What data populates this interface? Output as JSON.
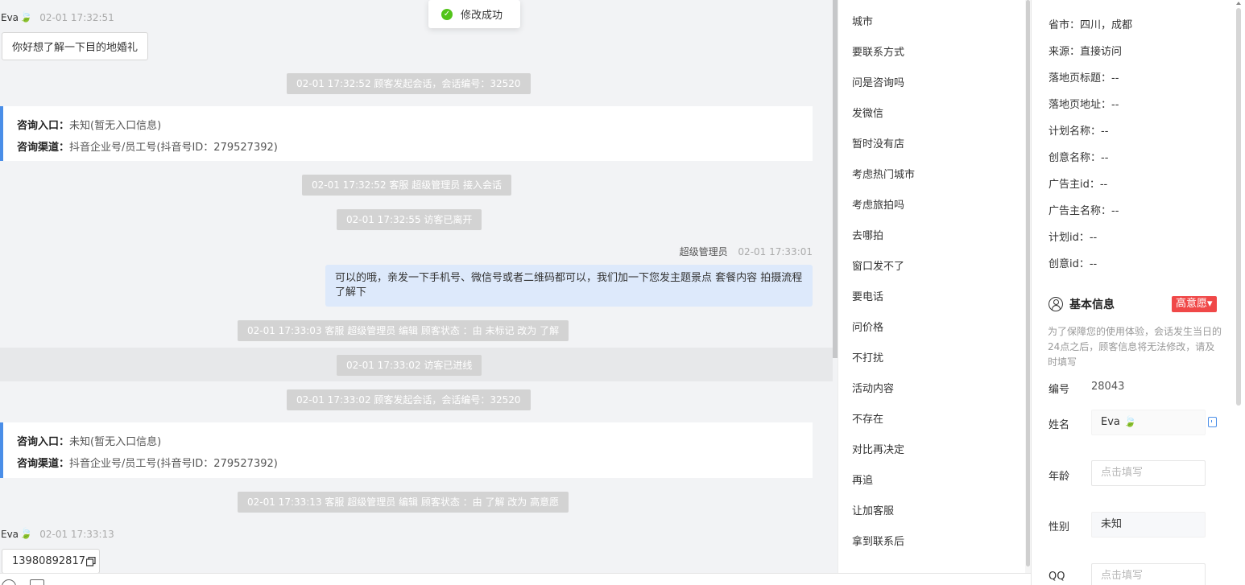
{
  "toast": {
    "text": "修改成功"
  },
  "chat": {
    "visitor_name": "Eva",
    "visitor_leaf": "🍃",
    "msg1": {
      "time": "02-01 17:32:51",
      "text": "你好想了解一下目的地婚礼"
    },
    "sys1": "02-01 17:32:52 顾客发起会话，会话编号：32520",
    "card1": {
      "entry_label": "咨询入口：",
      "entry_value": "未知(暂无入口信息)",
      "channel_label": "咨询渠道：",
      "channel_value": "抖音企业号/员工号(抖音号ID：279527392)"
    },
    "sys2": "02-01 17:32:52 客服 超级管理员 接入会话",
    "sys3": "02-01 17:32:55 访客已离开",
    "agent": {
      "name": "超级管理员",
      "time": "02-01 17:33:01",
      "text": "可以的哦，亲发一下手机号、微信号或者二维码都可以，我们加一下您发主题景点 套餐内容 拍摄流程了解下"
    },
    "sys4": "02-01 17:33:03 客服 超级管理员 编辑 顾客状态 ：由 未标记 改为 了解",
    "sys5": "02-01 17:33:02 访客已进线",
    "sys6": "02-01 17:33:02 顾客发起会话，会话编号：32520",
    "card2": {
      "entry_label": "咨询入口：",
      "entry_value": "未知(暂无入口信息)",
      "channel_label": "咨询渠道：",
      "channel_value": "抖音企业号/员工号(抖音号ID：279527392)"
    },
    "sys7": "02-01 17:33:13 客服 超级管理员 编辑 顾客状态 ：由 了解 改为 高意愿",
    "msg2": {
      "time": "02-01 17:33:13",
      "text": "13980892817"
    }
  },
  "quick_replies": [
    "城市",
    "要联系方式",
    "问是咨询吗",
    "发微信",
    "暂时没有店",
    "考虑热门城市",
    "考虑旅拍吗",
    "去哪拍",
    "窗口发不了",
    "要电话",
    "问价格",
    "不打扰",
    "活动内容",
    "不存在",
    "对比再决定",
    "再追",
    "让加客服",
    "拿到联系后"
  ],
  "info": {
    "source_rows": [
      "省市：四川，成都",
      "来源：直接访问",
      "落地页标题：--",
      "落地页地址：--",
      "计划名称：--",
      "创意名称：--",
      "广告主id：--",
      "广告主名称：--",
      "计划id：--",
      "创意id：--"
    ],
    "section_title": "基本信息",
    "intent_badge": "高意愿▾",
    "notice": "为了保障您的使用体验，会话发生当日的24点之后，顾客信息将无法修改，请及时填写",
    "id_label": "编号",
    "id_value": "28043",
    "name_label": "姓名",
    "name_value": "Eva 🍃",
    "age_label": "年龄",
    "age_placeholder": "点击填写",
    "gender_label": "性别",
    "gender_value": "未知",
    "qq_label": "QQ",
    "qq_placeholder": "点击填写"
  },
  "colors": {
    "accent": "#4a8ee8",
    "badge": "#f04848",
    "success": "#52c41a",
    "agent_bubble": "#dde9fb"
  }
}
